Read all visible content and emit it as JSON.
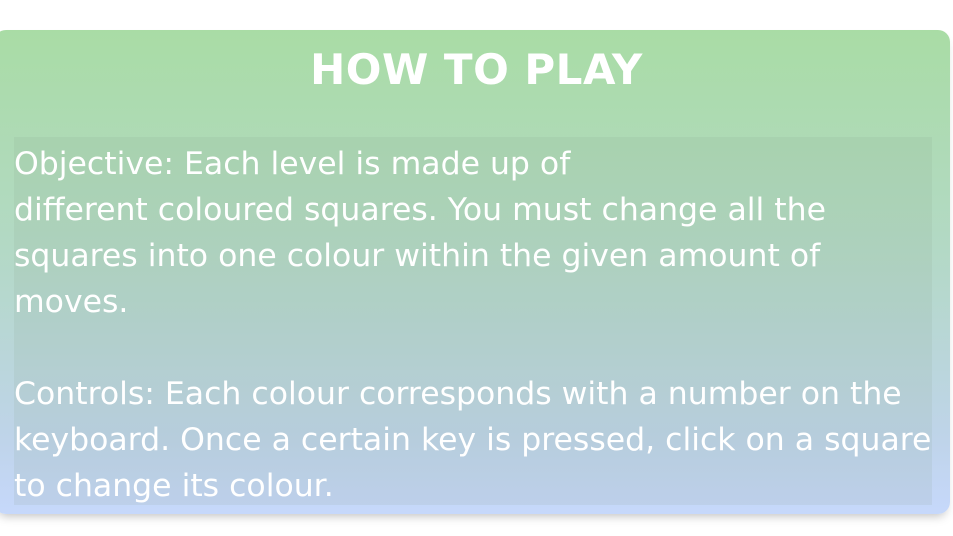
{
  "dialog": {
    "title": "HOW TO PLAY",
    "objective_line1": "Objective: Each level is made up of",
    "objective_line2": "different coloured squares. You must change all the squares into one colour within the given amount of moves.",
    "controls": "Controls: Each colour corresponds with a number on the keyboard. Once a certain key is pressed, click on a square to change its colour."
  },
  "colors": {
    "panel_top": "#a9dca5",
    "panel_bottom": "#c6d8fb",
    "text": "#ffffff"
  }
}
